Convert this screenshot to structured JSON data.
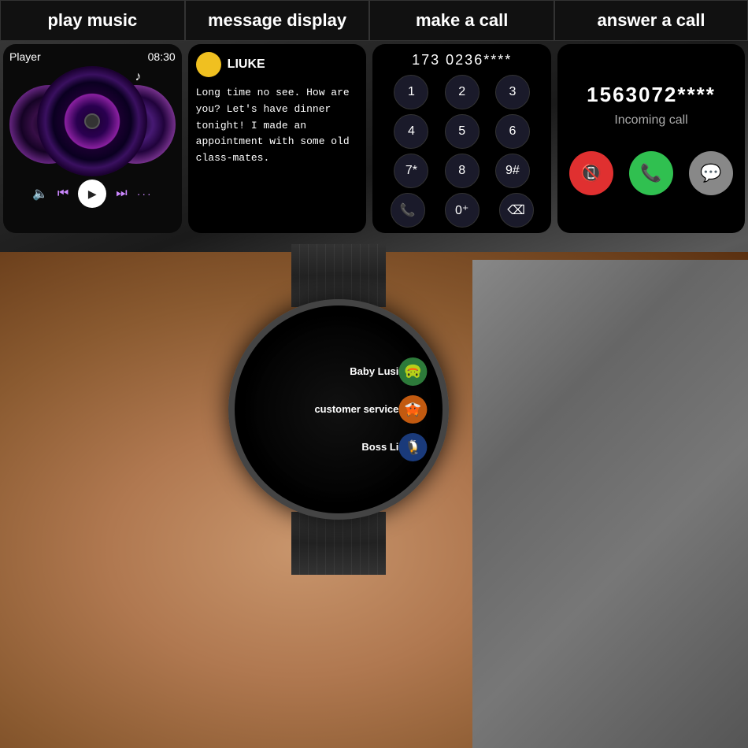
{
  "panels": {
    "music": {
      "label": "play music",
      "player_label": "Player",
      "time": "08:30",
      "controls": {
        "volume": "🔈",
        "prev": "⏮",
        "play": "▶",
        "next": "⏭",
        "dots": "···"
      }
    },
    "message": {
      "label": "message display",
      "sender": "LIUKE",
      "body": "Long time no see. How are you? Let's have dinner tonight! I made an appointment with some old class-mates."
    },
    "dial": {
      "label": "make a call",
      "number": "173 0236****",
      "keys": [
        "1",
        "2",
        "3",
        "4",
        "5",
        "6",
        "7*",
        "8",
        "9#",
        "📞",
        "0+",
        "⌫"
      ]
    },
    "answer": {
      "label": "answer a call",
      "number": "1563072****",
      "incoming_label": "Incoming call",
      "decline_icon": "📵",
      "accept_icon": "📞",
      "message_icon": "💬"
    }
  },
  "watch": {
    "contacts": [
      {
        "name": "Baby Lusi",
        "avatar_color": "green",
        "emoji": "🐸"
      },
      {
        "name": "customer service",
        "avatar_color": "orange",
        "emoji": "🦊"
      },
      {
        "name": "Boss Li",
        "avatar_color": "blue",
        "emoji": "🐧"
      }
    ]
  }
}
